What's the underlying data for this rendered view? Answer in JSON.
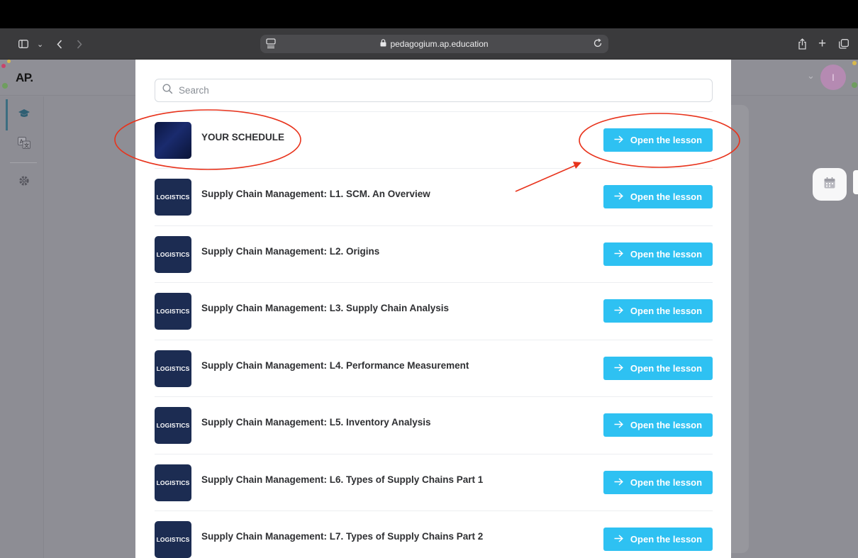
{
  "browser": {
    "url": "pedagogium.ap.education"
  },
  "app": {
    "logo": "AP.",
    "user_initial": "I"
  },
  "search": {
    "placeholder": "Search"
  },
  "lessons": [
    {
      "badge": "",
      "title": "YOUR SCHEDULE",
      "button": "Open the lesson"
    },
    {
      "badge": "LOGISTICS",
      "title": "Supply Chain Management: L1. SCM. An Overview",
      "button": "Open the lesson"
    },
    {
      "badge": "LOGISTICS",
      "title": "Supply Chain Management: L2. Origins",
      "button": "Open the lesson"
    },
    {
      "badge": "LOGISTICS",
      "title": "Supply Chain Management: L3. Supply Chain Analysis",
      "button": "Open the lesson"
    },
    {
      "badge": "LOGISTICS",
      "title": "Supply Chain Management: L4. Performance Measurement",
      "button": "Open the lesson"
    },
    {
      "badge": "LOGISTICS",
      "title": "Supply Chain Management: L5. Inventory Analysis",
      "button": "Open the lesson"
    },
    {
      "badge": "LOGISTICS",
      "title": "Supply Chain Management: L6. Types of Supply Chains Part 1",
      "button": "Open the lesson"
    },
    {
      "badge": "LOGISTICS",
      "title": "Supply Chain Management: L7. Types of Supply Chains Part 2",
      "button": "Open the lesson"
    }
  ],
  "colors": {
    "accent": "#2ec1f2",
    "annotation": "#e8331c",
    "thumb": "#1c2c52"
  }
}
